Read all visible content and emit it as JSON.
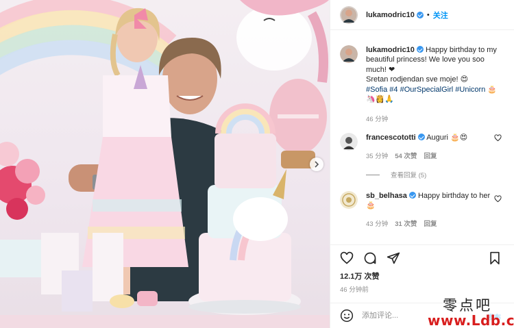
{
  "post": {
    "username": "lukamodric10",
    "follow_label": "关注",
    "dot": "•"
  },
  "caption": {
    "username": "lukamodric10",
    "line1": "Happy birthday to my",
    "line2": "beautiful princess! We love you soo",
    "line3": "much! ❤",
    "line4": "Sretan rodjendan sve moje! 😍",
    "hashtags": [
      {
        "text": "#Sofia"
      },
      {
        "text": "#4"
      },
      {
        "text": "#OurSpecialGirl"
      },
      {
        "text": "#Unicorn"
      }
    ],
    "tail_emoji": "🎂",
    "emoji_line": "🦄👸🙏",
    "time": "46 分钟"
  },
  "comments": [
    {
      "username": "francescototti",
      "text": "Auguri 🎂😍",
      "time": "35 分钟",
      "likes": "54 次赞",
      "reply": "回复"
    },
    {
      "username": "sb_belhasa",
      "text": "Happy birthday to her",
      "text2": "🎂",
      "time": "43 分钟",
      "likes": "31 次赞",
      "reply": "回复"
    }
  ],
  "view_replies": "查看回复 (5)",
  "likes_count": "12.1万 次赞",
  "post_time": "46 分钟前",
  "add_comment": {
    "placeholder": "添加评论...",
    "post_label": "发布"
  },
  "icons": {
    "like": "heart-icon",
    "comment": "comment-icon",
    "share": "paper-plane-icon",
    "save": "bookmark-icon",
    "emoji": "smiley-icon",
    "next": "chevron-right-icon"
  },
  "colors": {
    "link": "#0095f6",
    "hashtag": "#00376b",
    "muted": "#8e8e8e",
    "verified": "#3897f0",
    "heart": "#ed4956"
  },
  "watermark": {
    "line1": "零点吧",
    "line2": "www.Ldb.cc"
  }
}
